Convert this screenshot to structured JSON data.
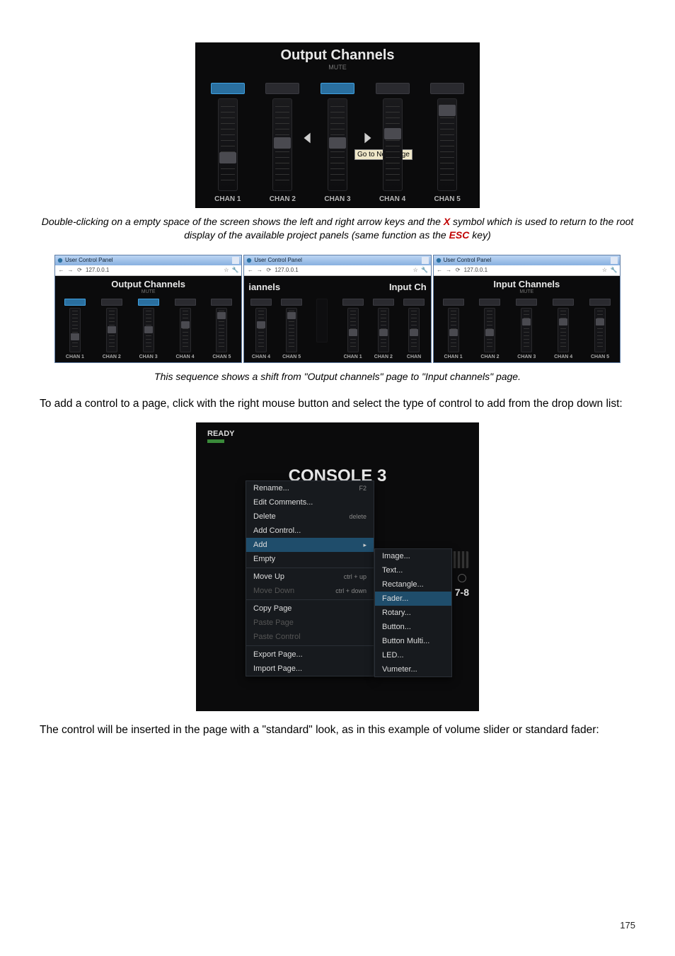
{
  "page_number": "175",
  "caption1_parts": {
    "a": "Double-clicking on a empty space of the screen shows the left and right arrow keys and the ",
    "x": "X",
    "b": " symbol which is used to return to the root display of the available project panels (same function as the ",
    "esc": "ESC",
    "c": " key)"
  },
  "caption2": "This sequence shows a shift from \"Output channels\" page  to \"Input channels\" page.",
  "para1": "To add a control to a page, click with the right mouse button and select the type of control to add from the drop down list:",
  "para2": "The control will be inserted in the page with a \"standard\" look, as in this example of volume slider or standard fader:",
  "fig1": {
    "title": "Output Channels",
    "subtitle": "MUTE",
    "tooltip": "Go to Next Page",
    "channels": [
      "CHAN 1",
      "CHAN 2",
      "CHAN 3",
      "CHAN 4",
      "CHAN 5"
    ]
  },
  "browser": {
    "tab_title": "User Control Panel",
    "url": "127.0.0.1",
    "panels": {
      "output": "Output Channels",
      "input": "Input Channels",
      "mute": "MUTE"
    },
    "mid_left": "iannels",
    "mid_right": "Input Ch",
    "channels": [
      "CHAN 1",
      "CHAN 2",
      "CHAN 3",
      "CHAN 4",
      "CHAN 5"
    ],
    "channels_mid": [
      "CHAN 4",
      "CHAN 5",
      "CHAN 1",
      "CHAN 2",
      "CHAN"
    ]
  },
  "fig3": {
    "ready": "READY",
    "title": "CONSOLE 3",
    "badge": "7-8",
    "menu": [
      {
        "label": "Rename...",
        "hint": "F2"
      },
      {
        "label": "Edit Comments..."
      },
      {
        "label": "Delete",
        "hint": "delete"
      },
      {
        "label": "Add Control..."
      },
      {
        "label": "Add",
        "arrow": true,
        "selected": true
      },
      {
        "label": "Empty"
      },
      {
        "label": "Move Up",
        "hint": "ctrl + up"
      },
      {
        "label": "Move Down",
        "hint": "ctrl + down",
        "disabled": true
      },
      {
        "label": "Copy Page"
      },
      {
        "label": "Paste Page",
        "disabled": true
      },
      {
        "label": "Paste Control",
        "disabled": true
      },
      {
        "label": "Export Page..."
      },
      {
        "label": "Import Page..."
      }
    ],
    "submenu": [
      {
        "label": "Image..."
      },
      {
        "label": "Text..."
      },
      {
        "label": "Rectangle..."
      },
      {
        "label": "Fader...",
        "selected": true
      },
      {
        "label": "Rotary..."
      },
      {
        "label": "Button..."
      },
      {
        "label": "Button Multi..."
      },
      {
        "label": "LED..."
      },
      {
        "label": "Vumeter..."
      }
    ]
  }
}
